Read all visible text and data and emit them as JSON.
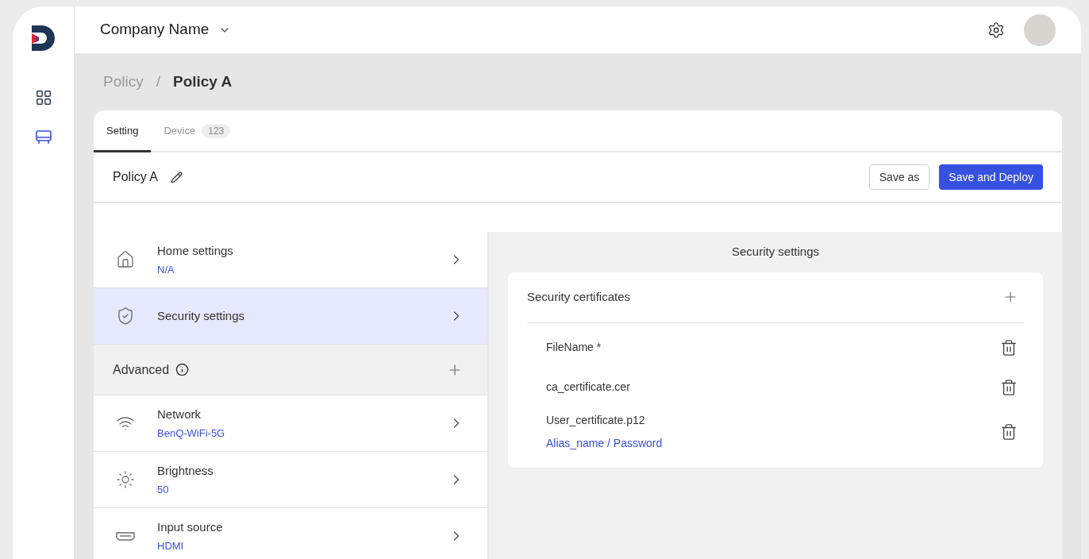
{
  "nav": [
    {
      "selected": false
    },
    {
      "selected": true
    }
  ],
  "header": {
    "company": "Company Name"
  },
  "breadcrumb": [
    "Policy",
    "/",
    "Policy A"
  ],
  "tabs": [
    {
      "label": "Setting",
      "selected": true
    },
    {
      "label": "Device",
      "count": "123",
      "selected": false
    }
  ],
  "policy": {
    "name": "Policy A",
    "buttons": [
      {
        "label": "Save as",
        "kind": "secondary"
      },
      {
        "label": "Save and Deploy",
        "kind": "primary"
      }
    ]
  },
  "settings": [
    {
      "kind": "item",
      "title": "Home settings",
      "value": "N/A",
      "selected": false
    },
    {
      "kind": "item",
      "title": "Security settings",
      "selected": true
    },
    {
      "kind": "section",
      "title": "Advanced"
    },
    {
      "kind": "item",
      "title": "Network",
      "value": "BenQ-WiFi-5G",
      "selected": false
    },
    {
      "kind": "item",
      "title": "Brightness",
      "value": "50",
      "selected": false
    },
    {
      "kind": "item",
      "title": "Input source",
      "value": "HDMI",
      "selected": false
    }
  ],
  "detail": {
    "title": "Security settings",
    "card_title": "Security certificates",
    "certificates": [
      {
        "name": "FileName *"
      },
      {
        "name": "ca_certificate.cer"
      },
      {
        "name": "User_certificate.p12",
        "link": "Alias_name / Password"
      }
    ]
  }
}
